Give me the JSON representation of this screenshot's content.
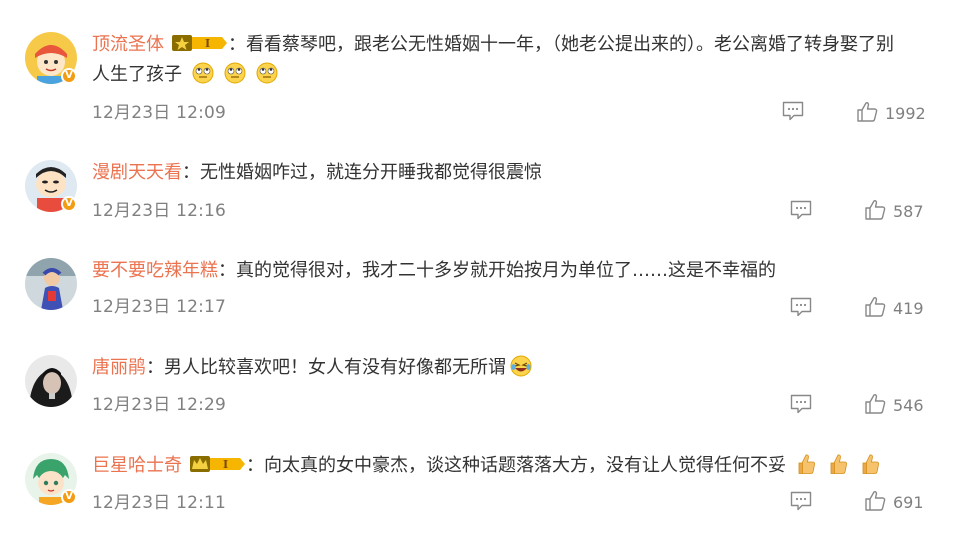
{
  "comments": [
    {
      "username": "顶流圣体",
      "vip": true,
      "text_line1": "：看看蔡琴吧，跟老公无性婚姻十一年，（她老公提出来的）。老公离婚了转身娶了别",
      "text_line2": "人生了孩子",
      "emojis": [
        "eye-roll-emoji",
        "eye-roll-emoji",
        "eye-roll-emoji"
      ],
      "time": "12月23日 12:09",
      "likes": "1992",
      "verified": true
    },
    {
      "username": "漫剧天天看",
      "vip": false,
      "text_line1": "：无性婚姻咋过，就连分开睡我都觉得很震惊",
      "time": "12月23日 12:16",
      "likes": "587",
      "verified": true
    },
    {
      "username": "要不要吃辣年糕",
      "vip": false,
      "text_line1": "：真的觉得很对，我才二十多岁就开始按月为单位了……这是不幸福的",
      "time": "12月23日 12:17",
      "likes": "419",
      "verified": false
    },
    {
      "username": "唐丽鹃",
      "vip": false,
      "text_line1": "：男人比较喜欢吧！女人有没有好像都无所谓",
      "emojis": [
        "laugh-cry-emoji"
      ],
      "time": "12月23日 12:29",
      "likes": "546",
      "verified": false
    },
    {
      "username": "巨星哈士奇",
      "vip": true,
      "text_line1": "：向太真的女中豪杰，谈这种话题落落大方，没有让人觉得任何不妥",
      "emojis": [
        "thumbs-up-emoji",
        "thumbs-up-emoji",
        "thumbs-up-emoji"
      ],
      "time": "12月23日 12:11",
      "likes": "691",
      "verified": true
    }
  ],
  "vip_badge": {
    "level": "I"
  },
  "verified_badge": "V",
  "colors": {
    "username": "#eb7350",
    "meta": "#808080",
    "text": "#333333",
    "vip_gold": "#f5b500"
  }
}
